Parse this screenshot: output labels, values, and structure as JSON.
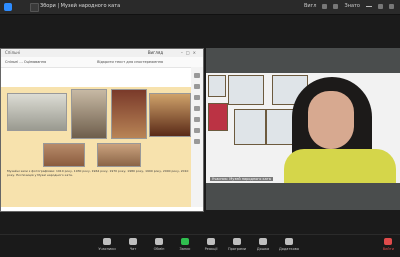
{
  "window": {
    "title": "Збори | Музей народного ката"
  },
  "topbar": {
    "right_label_1": "Вигл",
    "right_label_2": "Знато"
  },
  "shared_window": {
    "title": "Спільні",
    "right_label": "Вигляд",
    "menu_left": "Спільні ... Оцінювання",
    "menu_right": "Відкрити текст для спостереження",
    "caption": "Музейні зали з фотографіями: 1910 року, 1930 року, 1964 року, 1970 року, 1980 року, 1990 року, 2000 року, 2010 року. Експозиція у Музеї народного ката."
  },
  "video": {
    "label": "Учасник: Музей народного ката"
  },
  "toolbar": {
    "items": [
      {
        "label": "Учасники",
        "icon": "participants-icon"
      },
      {
        "label": "Чат",
        "icon": "chat-icon"
      },
      {
        "label": "Обмін",
        "icon": "share-screen-icon"
      },
      {
        "label": "Запис",
        "icon": "record-icon"
      },
      {
        "label": "Реакції",
        "icon": "reactions-icon"
      },
      {
        "label": "Програми",
        "icon": "apps-icon"
      },
      {
        "label": "Дошка",
        "icon": "whiteboard-icon"
      },
      {
        "label": "Додатково",
        "icon": "more-icon"
      }
    ],
    "end_label": "Вийти"
  },
  "colors": {
    "share_accent": "#2fbf4f",
    "end_accent": "#e04b4b",
    "slide_background": "#f7e2ad"
  }
}
